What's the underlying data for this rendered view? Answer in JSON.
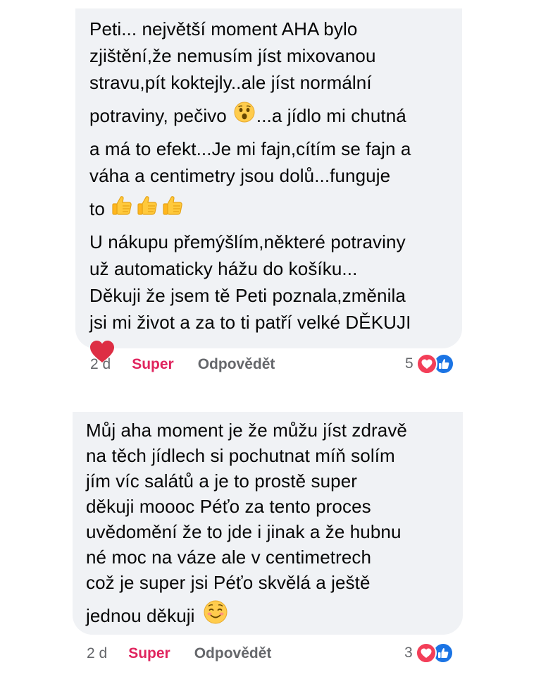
{
  "comments": [
    {
      "lines": [
        "Peti... největší moment AHA bylo",
        "zjištění,že nemusím jíst mixovanou",
        "stravu,pít koktejly..ale jíst normální",
        "potraviny, pečivo",
        "...a jídlo mi chutná",
        "a má to efekt...Je mi fajn,cítím se fajn a",
        "váha a centimetry jsou dolů...funguje",
        "to",
        "U nákupu přemýšlím,některé potraviny",
        "už automaticky hážu do košíku...",
        "Děkuji že jsem tě Peti poznala,změnila",
        "jsi mi život a za to ti patří velké DĚKUJI"
      ],
      "time": "2 d",
      "react_label": "Super",
      "reply_label": "Odpovědět",
      "reaction_count": "5",
      "reaction_icons": [
        "love-icon",
        "like-icon"
      ]
    },
    {
      "lines": [
        "Můj aha moment je že můžu jíst zdravě",
        "na těch jídlech si pochutnat míň solím",
        "jím víc salátů a je to prostě super",
        "děkuji moooc Péťo za tento  proces",
        "uvědomění že to jde i jinak a že hubnu",
        "né moc na váze ale v  centimetrech",
        "což je super jsi Péťo skvělá a ještě",
        "jednou děkuji"
      ],
      "time": "2 d",
      "react_label": "Super",
      "reply_label": "Odpovědět",
      "reaction_count": "3",
      "reaction_icons": [
        "love-icon",
        "like-icon"
      ]
    }
  ],
  "colors": {
    "bubble": "#f0f2f5",
    "react_active": "#e0245e",
    "meta": "#65676b",
    "love": "#f33e58",
    "like": "#1b74e4"
  },
  "emojis": [
    "astonished-face-icon",
    "thumbs-up-icon",
    "red-heart-icon",
    "smiling-face-icon"
  ]
}
